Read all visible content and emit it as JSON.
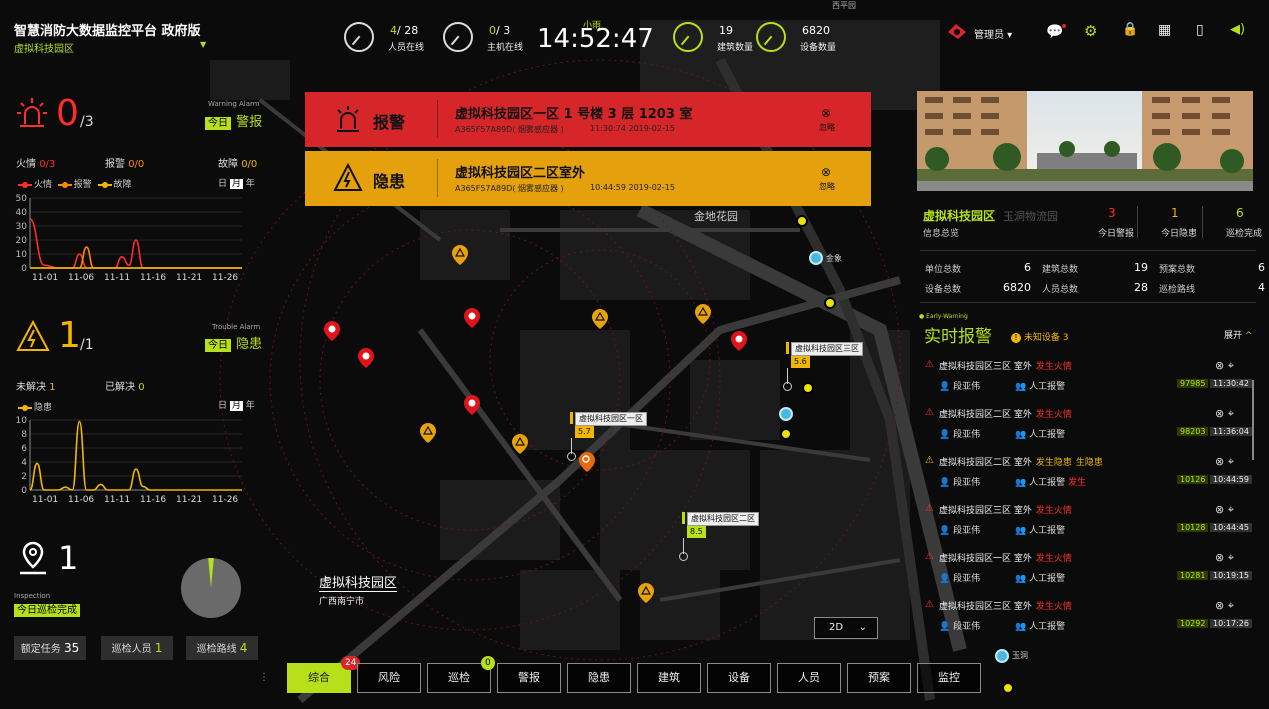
{
  "app": {
    "title": "智慧消防大数据监控平台 政府版",
    "region": "虚拟科技园区",
    "weather": "小雨",
    "clock": "14:52:47"
  },
  "top_stats": [
    {
      "value": "4",
      "total": "/ 28",
      "label": "人员在线",
      "ring": "white"
    },
    {
      "value": "0",
      "total": "/ 3",
      "label": "主机在线",
      "ring": "white"
    },
    {
      "value": "19",
      "total": "",
      "label": "建筑数量",
      "ring": "lime"
    },
    {
      "value": "6820",
      "total": "",
      "label": "设备数量",
      "ring": "lime"
    }
  ],
  "user": {
    "name": "管理员"
  },
  "left": {
    "warning": {
      "count": "0",
      "total": "/3",
      "en_label": "Warning Alarm",
      "today": "今日",
      "label": "警报",
      "fire_label": "火情",
      "fire_val": "0/3",
      "alarm_label": "报警",
      "alarm_val": "0/0",
      "fault_label": "故障",
      "fault_val": "0/0",
      "legend": [
        "火情",
        "报警",
        "故障"
      ],
      "periods": [
        "日",
        "月",
        "年"
      ],
      "active_period": "月"
    },
    "trouble": {
      "count": "1",
      "total": "/1",
      "en_label": "Trouble Alarm",
      "today": "今日",
      "label": "隐患",
      "unresolved_label": "未解决",
      "unresolved_val": "1",
      "resolved_label": "已解决",
      "resolved_val": "0",
      "legend": [
        "隐患"
      ],
      "periods": [
        "日",
        "月",
        "年"
      ],
      "active_period": "月"
    },
    "inspection": {
      "count": "1",
      "en_label": "Inspection",
      "label": "今日巡检完成",
      "progress": 0.03,
      "buttons": [
        {
          "label": "额定任务",
          "value": "35"
        },
        {
          "label": "巡检人员",
          "value": "1"
        },
        {
          "label": "巡检路线",
          "value": "4"
        }
      ]
    }
  },
  "chart_data": [
    {
      "type": "line",
      "title": "",
      "x": [
        "11-01",
        "11-06",
        "11-11",
        "11-16",
        "11-21",
        "11-26"
      ],
      "ylim": [
        0,
        50
      ],
      "yticks": [
        0,
        10,
        20,
        30,
        40,
        50
      ],
      "series": [
        {
          "name": "火情",
          "color": "#ff2c2c",
          "points": [
            [
              0,
              35
            ],
            [
              2,
              2
            ],
            [
              4,
              0
            ],
            [
              6,
              0
            ],
            [
              7,
              10
            ],
            [
              8,
              0
            ],
            [
              10,
              0
            ],
            [
              12,
              0
            ],
            [
              13,
              8
            ],
            [
              14,
              2
            ],
            [
              15,
              20
            ],
            [
              16,
              0
            ],
            [
              18,
              0
            ],
            [
              30,
              0
            ]
          ]
        },
        {
          "name": "报警",
          "color": "#ff8a00",
          "points": [
            [
              0,
              0
            ],
            [
              7,
              0
            ],
            [
              8,
              15
            ],
            [
              9,
              0
            ],
            [
              30,
              0
            ]
          ]
        },
        {
          "name": "故障",
          "color": "#f2b600",
          "points": [
            [
              0,
              0
            ],
            [
              30,
              0
            ]
          ]
        }
      ]
    },
    {
      "type": "line",
      "title": "",
      "x": [
        "11-01",
        "11-06",
        "11-11",
        "11-16",
        "11-21",
        "11-26"
      ],
      "ylim": [
        0,
        10
      ],
      "yticks": [
        0,
        2,
        4,
        6,
        8,
        10
      ],
      "series": [
        {
          "name": "隐患",
          "color": "#f2b600",
          "points": [
            [
              0,
              0
            ],
            [
              1,
              3.8
            ],
            [
              2,
              0
            ],
            [
              4,
              0
            ],
            [
              5,
              0.4
            ],
            [
              6,
              0
            ],
            [
              7,
              9.8
            ],
            [
              8,
              0
            ],
            [
              9,
              0
            ],
            [
              10,
              0.8
            ],
            [
              11,
              0
            ],
            [
              14,
              0
            ],
            [
              15,
              3
            ],
            [
              16,
              0.5
            ],
            [
              17,
              0
            ],
            [
              30,
              0
            ]
          ]
        }
      ]
    }
  ],
  "banners": [
    {
      "type": "报警",
      "title": "虚拟科技园区一区 1 号楼 3 层 1203 室",
      "device": "A365F57A89D( 烟雾感应器 )",
      "time": "11:30:74 2019-02-15",
      "ignore": "忽略",
      "color": "#d6262a"
    },
    {
      "type": "隐患",
      "title": "虚拟科技园区二区室外",
      "device": "A365F57A89D( 烟雾感应器 )",
      "time": "10:44:59 2019-02-15",
      "ignore": "忽略",
      "color": "#e5a00d"
    }
  ],
  "map": {
    "place_labels": [
      "金地花园",
      "金象",
      "玉洞",
      "西平园"
    ],
    "area_name": "虚拟科技园区",
    "city": "广西南宁市",
    "view_mode": "2D",
    "callouts": [
      {
        "name": "虚拟科技园区一区",
        "value": "5.7",
        "color": "#f2b600"
      },
      {
        "name": "虚拟科技园区二区",
        "value": "8.5",
        "color": "#b6e01a"
      },
      {
        "name": "虚拟科技园区三区",
        "value": "5.6",
        "color": "#f2b600"
      }
    ]
  },
  "right": {
    "park_name": "虚拟科技园区",
    "park_alt": "玉洞物流园",
    "info_label": "信息总览",
    "stats": [
      {
        "value": "3",
        "label": "今日警报",
        "color": "#ff2c2c"
      },
      {
        "value": "1",
        "label": "今日隐患",
        "color": "#f2b600"
      },
      {
        "value": "6",
        "label": "巡检完成",
        "color": "#b6e01a"
      }
    ],
    "details": [
      {
        "label": "单位总数",
        "value": "6"
      },
      {
        "label": "建筑总数",
        "value": "19"
      },
      {
        "label": "预案总数",
        "value": "6"
      },
      {
        "label": "设备总数",
        "value": "6820"
      },
      {
        "label": "人员总数",
        "value": "28"
      },
      {
        "label": "巡检路线",
        "value": "4"
      }
    ],
    "early_en": "Early-Warning",
    "realtime_title": "实时报警",
    "unknown_devices": "未知设备 3",
    "expand": "展开",
    "alarms": [
      {
        "kind": "fire",
        "location": "虚拟科技园区三区 室外",
        "status": "发生火情",
        "extra": "",
        "person": "段亚伟",
        "source": "人工报警",
        "source_tag": "",
        "code": "97985",
        "time": "11:30:42"
      },
      {
        "kind": "fire",
        "location": "虚拟科技园区二区 室外",
        "status": "发生火情",
        "extra": "",
        "person": "段亚伟",
        "source": "人工报警",
        "source_tag": "",
        "code": "98203",
        "time": "11:36:04"
      },
      {
        "kind": "hazard",
        "location": "虚拟科技园区二区 室外",
        "status": "发生隐患",
        "extra": "生隐患",
        "person": "段亚伟",
        "source": "人工报警",
        "source_tag": "发生",
        "code": "10126",
        "time": "10:44:59"
      },
      {
        "kind": "fire",
        "location": "虚拟科技园区三区 室外",
        "status": "发生火情",
        "extra": "",
        "person": "段亚伟",
        "source": "人工报警",
        "source_tag": "",
        "code": "10128",
        "time": "10:44:45"
      },
      {
        "kind": "fire",
        "location": "虚拟科技园区一区 室外",
        "status": "发生火情",
        "extra": "",
        "person": "段亚伟",
        "source": "人工报警",
        "source_tag": "",
        "code": "10281",
        "time": "10:19:15"
      },
      {
        "kind": "fire",
        "location": "虚拟科技园区三区 室外",
        "status": "发生火情",
        "extra": "",
        "person": "段亚伟",
        "source": "人工报警",
        "source_tag": "",
        "code": "10292",
        "time": "10:17:26"
      }
    ]
  },
  "tabs": [
    {
      "label": "综合",
      "active": true,
      "badge": "24",
      "badge_color": "#d6262a"
    },
    {
      "label": "风险",
      "active": false,
      "badge": ""
    },
    {
      "label": "巡检",
      "active": false,
      "badge": "0",
      "badge_color": "#b6e01a"
    },
    {
      "label": "警报",
      "active": false,
      "badge": ""
    },
    {
      "label": "隐患",
      "active": false,
      "badge": ""
    },
    {
      "label": "建筑",
      "active": false,
      "badge": ""
    },
    {
      "label": "设备",
      "active": false,
      "badge": ""
    },
    {
      "label": "人员",
      "active": false,
      "badge": ""
    },
    {
      "label": "预案",
      "active": false,
      "badge": ""
    },
    {
      "label": "监控",
      "active": false,
      "badge": ""
    }
  ]
}
